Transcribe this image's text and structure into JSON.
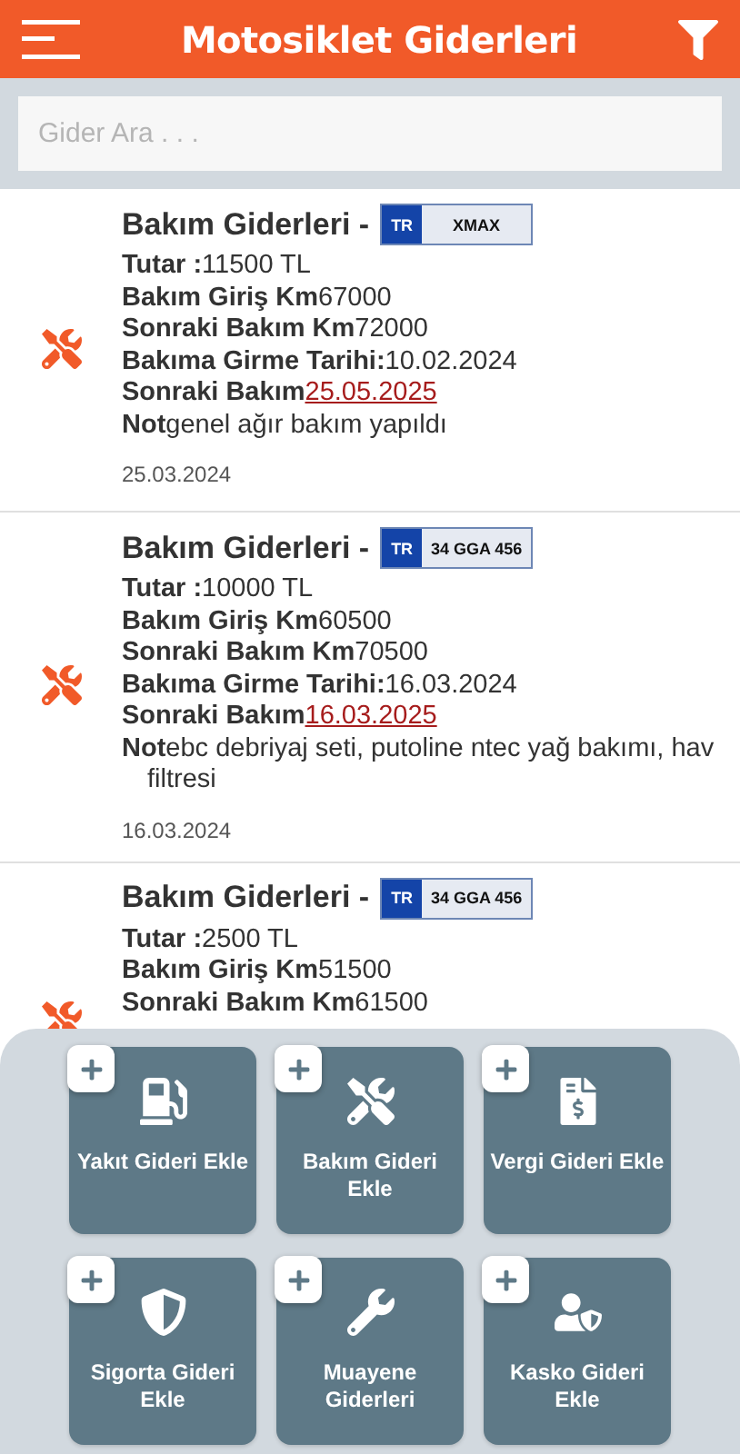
{
  "header": {
    "title": "Motosiklet Giderleri"
  },
  "search": {
    "placeholder": "Gider Ara . . ."
  },
  "expenses": [
    {
      "title": "Bakım Giderleri -",
      "plate": {
        "country": "TR",
        "number": "XMAX"
      },
      "fields": [
        {
          "kind": "text",
          "label": "Tutar :",
          "value": "11500 TL"
        },
        {
          "kind": "text",
          "label": "Bakım Giriş Km",
          "value": "67000"
        },
        {
          "kind": "text",
          "label": "Sonraki Bakım Km",
          "value": "72000"
        },
        {
          "kind": "text",
          "label": "Bakıma Girme Tarihi:",
          "value": "10.02.2024"
        },
        {
          "kind": "link",
          "label": "Sonraki Bakım",
          "value": "25.05.2025"
        },
        {
          "kind": "note",
          "label": "Not",
          "lines": [
            "genel ağır bakım yapıldı"
          ]
        }
      ],
      "date": "25.03.2024"
    },
    {
      "title": "Bakım Giderleri -",
      "plate": {
        "country": "TR",
        "number": "34 GGA 456"
      },
      "fields": [
        {
          "kind": "text",
          "label": "Tutar :",
          "value": "10000 TL"
        },
        {
          "kind": "text",
          "label": "Bakım Giriş Km",
          "value": "60500"
        },
        {
          "kind": "text",
          "label": "Sonraki Bakım Km",
          "value": "70500"
        },
        {
          "kind": "text",
          "label": "Bakıma Girme Tarihi:",
          "value": "16.03.2024"
        },
        {
          "kind": "link",
          "label": "Sonraki Bakım",
          "value": "16.03.2025"
        },
        {
          "kind": "note",
          "label": "Not",
          "lines": [
            "ebc debriyaj seti, putoline ntec yağ bakımı, hav",
            "filtresi"
          ]
        }
      ],
      "date": "16.03.2024"
    },
    {
      "title": "Bakım Giderleri -",
      "plate": {
        "country": "TR",
        "number": "34 GGA 456"
      },
      "fields": [
        {
          "kind": "text",
          "label": "Tutar :",
          "value": "2500 TL"
        },
        {
          "kind": "text",
          "label": "Bakım Giriş Km",
          "value": "51500"
        },
        {
          "kind": "text",
          "label": "Sonraki Bakım Km",
          "value": "61500"
        }
      ]
    }
  ],
  "actions": [
    {
      "kind": "fuel",
      "label": "Yakıt Gideri Ekle"
    },
    {
      "kind": "maintenance",
      "label": "Bakım Gideri Ekle"
    },
    {
      "kind": "tax",
      "label": "Vergi Gideri Ekle"
    },
    {
      "kind": "insurance",
      "label": "Sigorta Gideri Ekle"
    },
    {
      "kind": "inspection",
      "label": "Muayene Giderleri"
    },
    {
      "kind": "casco",
      "label": "Kasko Gideri Ekle"
    }
  ]
}
